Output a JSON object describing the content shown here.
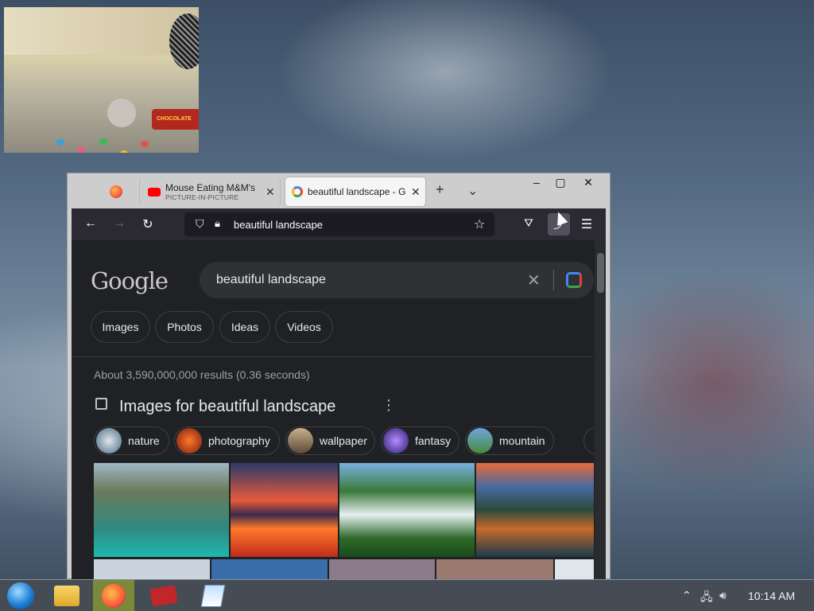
{
  "pip": {
    "title": "Mouse Eating M&M's",
    "tube_text": "CHOCOLATE"
  },
  "browser": {
    "tabs": [
      {
        "label": "Mouse Eating M&M's",
        "sub": "PICTURE-IN-PICTURE",
        "icon": "youtube-icon"
      },
      {
        "label": "beautiful landscape - G",
        "icon": "google-icon",
        "active": true
      }
    ],
    "window_buttons": {
      "minimize": "–",
      "maximize": "▢",
      "close": "✕"
    },
    "new_tab": "+",
    "list_all_tabs": "⌄",
    "url": "beautiful landscape"
  },
  "google": {
    "logo": "Google",
    "query": "beautiful landscape",
    "filters": [
      "Images",
      "Photos",
      "Ideas",
      "Videos"
    ],
    "stats": "About 3,590,000,000 results (0.36 seconds)",
    "images_heading": "Images for beautiful landscape",
    "suggestions": [
      "nature",
      "photography",
      "wallpaper",
      "fantasy",
      "mountain"
    ]
  },
  "taskbar": {
    "time": "10:14 AM",
    "apps": [
      "start-menu",
      "file-manager",
      "firefox",
      "media-player",
      "text-editor"
    ]
  },
  "colors": {
    "page_bg": "#202124",
    "navbar": "#2b2a33",
    "text": "#e8eaed",
    "muted": "#9aa0a6"
  }
}
